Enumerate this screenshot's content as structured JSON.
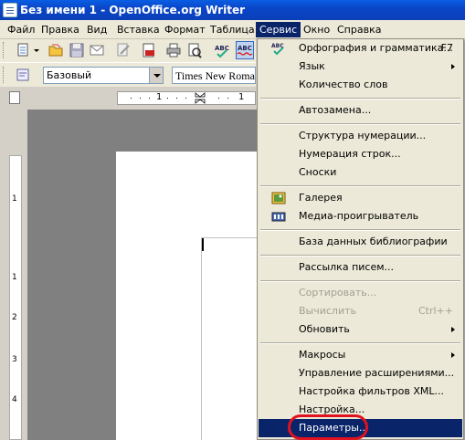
{
  "window": {
    "title": "Без имени 1 - OpenOffice.org Writer"
  },
  "menubar": [
    {
      "label": "Файл",
      "active": false
    },
    {
      "label": "Правка",
      "active": false
    },
    {
      "label": "Вид",
      "active": false
    },
    {
      "label": "Вставка",
      "active": false
    },
    {
      "label": "Формат",
      "active": false
    },
    {
      "label": "Таблица",
      "active": false
    },
    {
      "label": "Сервис",
      "active": true
    },
    {
      "label": "Окно",
      "active": false
    },
    {
      "label": "Справка",
      "active": false
    }
  ],
  "formatting": {
    "paragraph_style": "Базовый",
    "font_name": "Times New Roman"
  },
  "ruler": {
    "marks": [
      "1",
      "1"
    ]
  },
  "vruler": {
    "marks": [
      "1",
      "1",
      "2",
      "3",
      "4"
    ]
  },
  "service_menu": {
    "items": [
      {
        "label": "Орфография и грамматика...",
        "accel": "F7",
        "icon": "spellcheck-icon",
        "enabled": true,
        "submenu": false
      },
      {
        "label": "Язык",
        "accel": "",
        "enabled": true,
        "submenu": true
      },
      {
        "label": "Количество слов",
        "accel": "",
        "enabled": true,
        "submenu": false
      },
      {
        "label": "Автозамена...",
        "accel": "",
        "enabled": true,
        "submenu": false
      },
      {
        "label": "Структура нумерации...",
        "accel": "",
        "enabled": true,
        "submenu": false
      },
      {
        "label": "Нумерация строк...",
        "accel": "",
        "enabled": true,
        "submenu": false
      },
      {
        "label": "Сноски",
        "accel": "",
        "enabled": true,
        "submenu": false
      },
      {
        "label": "Галерея",
        "accel": "",
        "icon": "gallery-icon",
        "enabled": true,
        "submenu": false
      },
      {
        "label": "Медиа-проигрыватель",
        "accel": "",
        "icon": "media-player-icon",
        "enabled": true,
        "submenu": false
      },
      {
        "label": "База данных библиографии",
        "accel": "",
        "enabled": true,
        "submenu": false
      },
      {
        "label": "Рассылка писем...",
        "accel": "",
        "enabled": true,
        "submenu": false
      },
      {
        "label": "Сортировать...",
        "accel": "",
        "enabled": false,
        "submenu": false
      },
      {
        "label": "Вычислить",
        "accel": "Ctrl++",
        "enabled": false,
        "submenu": false
      },
      {
        "label": "Обновить",
        "accel": "",
        "enabled": true,
        "submenu": true
      },
      {
        "label": "Макросы",
        "accel": "",
        "enabled": true,
        "submenu": true
      },
      {
        "label": "Управление расширениями...",
        "accel": "",
        "enabled": true,
        "submenu": false
      },
      {
        "label": "Настройка фильтров XML...",
        "accel": "",
        "enabled": true,
        "submenu": false
      },
      {
        "label": "Настройка...",
        "accel": "",
        "enabled": true,
        "submenu": false
      },
      {
        "label": "Параметры...",
        "accel": "",
        "enabled": true,
        "submenu": false,
        "highlighted": true
      }
    ]
  },
  "colors": {
    "highlight": "#0a246a",
    "annotation_ring": "#e0121f",
    "titlebar": "#0a46c8"
  }
}
